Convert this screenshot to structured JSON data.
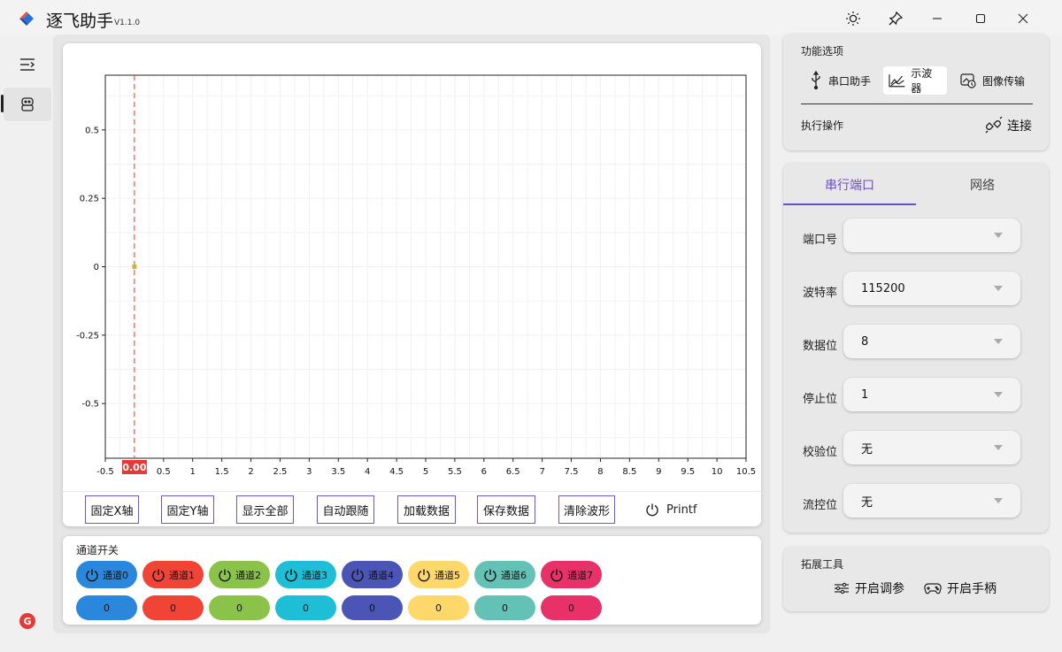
{
  "app": {
    "title": "逐飞助手",
    "version": "V1.1.0"
  },
  "scope": {
    "y_ticks": [
      "0.5",
      "0.25",
      "0",
      "-0.25",
      "-0.5"
    ],
    "x_ticks": [
      "-0.5",
      "0.5",
      "1",
      "1.5",
      "2",
      "2.5",
      "3",
      "3.5",
      "4",
      "4.5",
      "5",
      "5.5",
      "6",
      "6.5",
      "7",
      "7.5",
      "8",
      "8.5",
      "9",
      "9.5",
      "10",
      "10.5"
    ],
    "cursor_label": "0.00",
    "cursor_color": "#e53935"
  },
  "chart_data": {
    "type": "line",
    "xlim": [
      -0.5,
      10.5
    ],
    "ylim": [
      -0.7,
      0.7
    ],
    "grid": true,
    "x_ticks": [
      -0.5,
      0.5,
      1,
      1.5,
      2,
      2.5,
      3,
      3.5,
      4,
      4.5,
      5,
      5.5,
      6,
      6.5,
      7,
      7.5,
      8,
      8.5,
      9,
      9.5,
      10,
      10.5
    ],
    "y_ticks": [
      0.5,
      0.25,
      0,
      -0.25,
      -0.5
    ],
    "cursor_x": 0,
    "series": [
      {
        "x": [
          0
        ],
        "y": [
          0
        ],
        "color": "#c8b832"
      }
    ]
  },
  "toolbar": {
    "buttons": [
      "固定X轴",
      "固定Y轴",
      "显示全部",
      "自动跟随",
      "加载数据",
      "保存数据",
      "清除波形"
    ],
    "printf_label": "Printf"
  },
  "channels": {
    "title": "通道开关",
    "items": [
      {
        "label": "通道0",
        "value": "0",
        "color": "#2b87db"
      },
      {
        "label": "通道1",
        "value": "0",
        "color": "#f04436"
      },
      {
        "label": "通道2",
        "value": "0",
        "color": "#8bc34a"
      },
      {
        "label": "通道3",
        "value": "0",
        "color": "#1ebfd6"
      },
      {
        "label": "通道4",
        "value": "0",
        "color": "#4a55b5"
      },
      {
        "label": "通道5",
        "value": "0",
        "color": "#ffd86b"
      },
      {
        "label": "通道6",
        "value": "0",
        "color": "#63c2b5"
      },
      {
        "label": "通道7",
        "value": "0",
        "color": "#e83069"
      }
    ]
  },
  "functions": {
    "title": "功能选项",
    "serial_assistant": "串口助手",
    "oscilloscope": "示波器",
    "image_transfer": "图像传输",
    "exec_title": "执行操作",
    "connect": "连接"
  },
  "port_tabs": {
    "serial": "串行端口",
    "network": "网络"
  },
  "form": {
    "port_label": "端口号",
    "port_value": "",
    "baud_label": "波特率",
    "baud_value": "115200",
    "databits_label": "数据位",
    "databits_value": "8",
    "stopbits_label": "停止位",
    "stopbits_value": "1",
    "parity_label": "校验位",
    "parity_value": "无",
    "flow_label": "流控位",
    "flow_value": "无"
  },
  "extensions": {
    "title": "拓展工具",
    "tuning": "开启调参",
    "gamepad": "开启手柄"
  },
  "colors": {
    "accent": "#6a4fc9",
    "tool_border": "#6a5acd"
  }
}
